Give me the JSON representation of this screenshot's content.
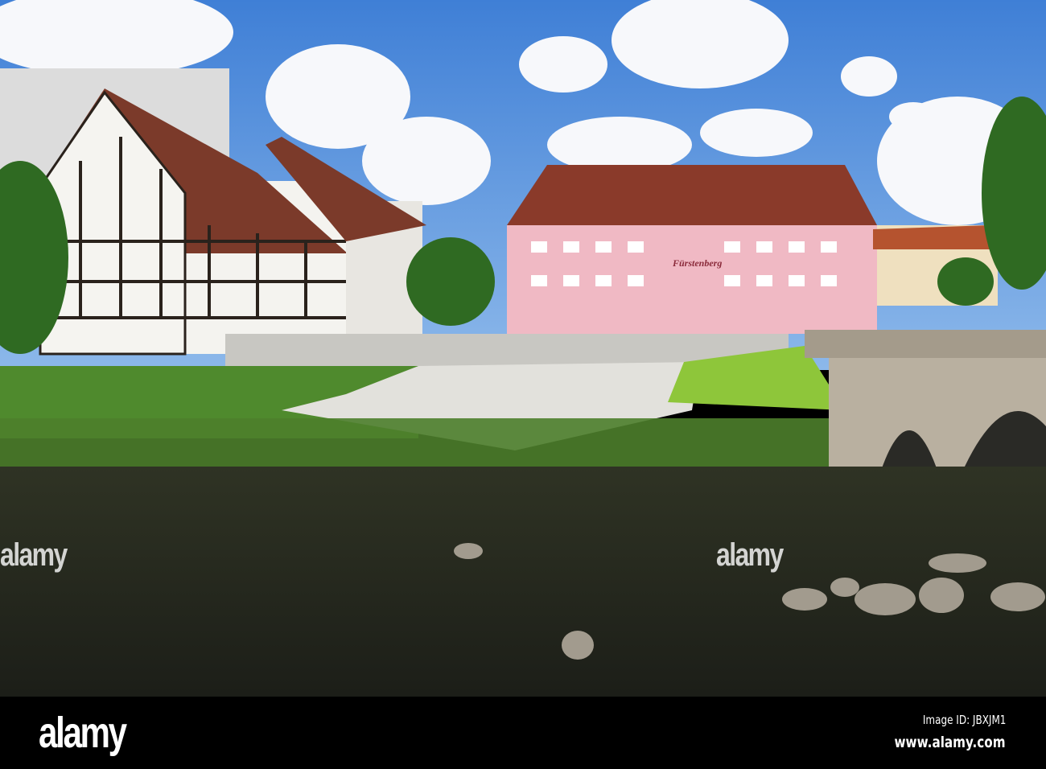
{
  "photo": {
    "subject": "Fürstenberg",
    "sign_text": "Fürstenberg"
  },
  "watermark": {
    "logo": "alamy",
    "center": "alamy"
  },
  "footer": {
    "logo": "alamy",
    "image_id": "Image ID: JBXJM1",
    "url": "www.alamy.com"
  }
}
